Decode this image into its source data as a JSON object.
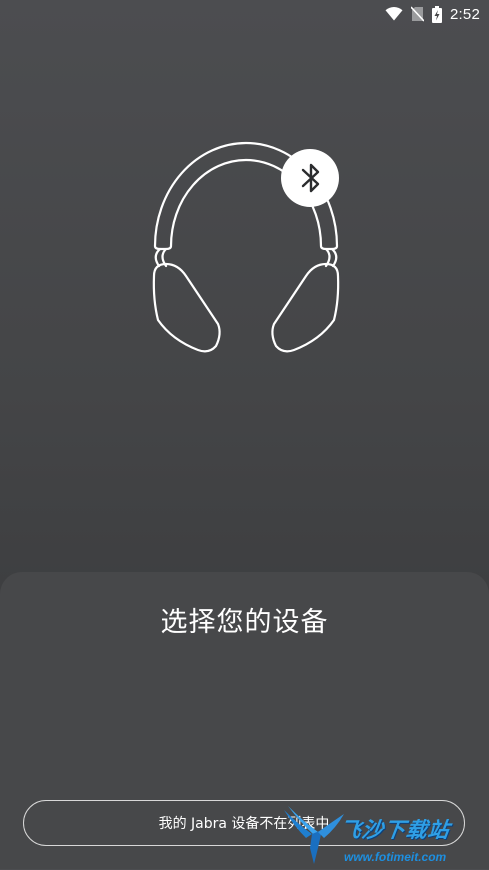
{
  "status_bar": {
    "time": "2:52",
    "icons": [
      "wifi-icon",
      "no-sim-icon",
      "battery-charging-icon"
    ]
  },
  "hero": {
    "icon": "headphones-icon",
    "badge_icon": "bluetooth-icon"
  },
  "sheet": {
    "title": "选择您的设备",
    "not_listed_button": "我的 Jabra 设备不在列表中"
  },
  "watermark": {
    "title": "飞沙下载站",
    "url": "www.fotimeit.com"
  },
  "colors": {
    "background": "#444547",
    "sheet": "#47484a",
    "text": "#ffffff",
    "button_border": "#d8d8d8"
  }
}
